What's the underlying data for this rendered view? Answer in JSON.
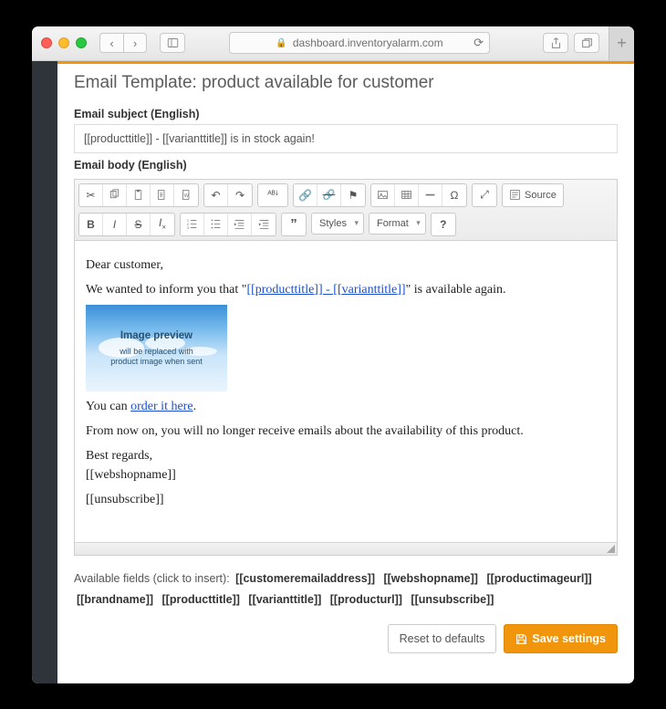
{
  "browser": {
    "url": "dashboard.inventoryalarm.com"
  },
  "page": {
    "title": "Email Template: product available for customer",
    "subject_label": "Email subject (English)",
    "subject_value": "[[producttitle]] - [[varianttitle]] is in stock again!",
    "body_label": "Email body (English)"
  },
  "toolbar": {
    "styles": "Styles",
    "format": "Format",
    "source": "Source"
  },
  "email_body": {
    "greeting": "Dear customer,",
    "line1_a": "We wanted to inform you that \"",
    "line1_token": "[[producttitle]] - [[varianttitle]]",
    "line1_b": "\" is available again.",
    "image_preview_title": "Image preview",
    "image_preview_sub": "will be replaced with\nproduct image when sent",
    "line2_a": "You can ",
    "line2_link": "order it here",
    "line2_b": ".",
    "line3": "From now on, you will no longer receive emails about the availability of this product.",
    "signoff": "Best regards,",
    "webshop": "[[webshopname]]",
    "unsub": "[[unsubscribe]]"
  },
  "available": {
    "label": "Available fields (click to insert):",
    "fields": [
      "[[customeremailaddress]]",
      "[[webshopname]]",
      "[[productimageurl]]",
      "[[brandname]]",
      "[[producttitle]]",
      "[[varianttitle]]",
      "[[producturl]]",
      "[[unsubscribe]]"
    ]
  },
  "buttons": {
    "reset": "Reset to defaults",
    "save": "Save settings"
  }
}
